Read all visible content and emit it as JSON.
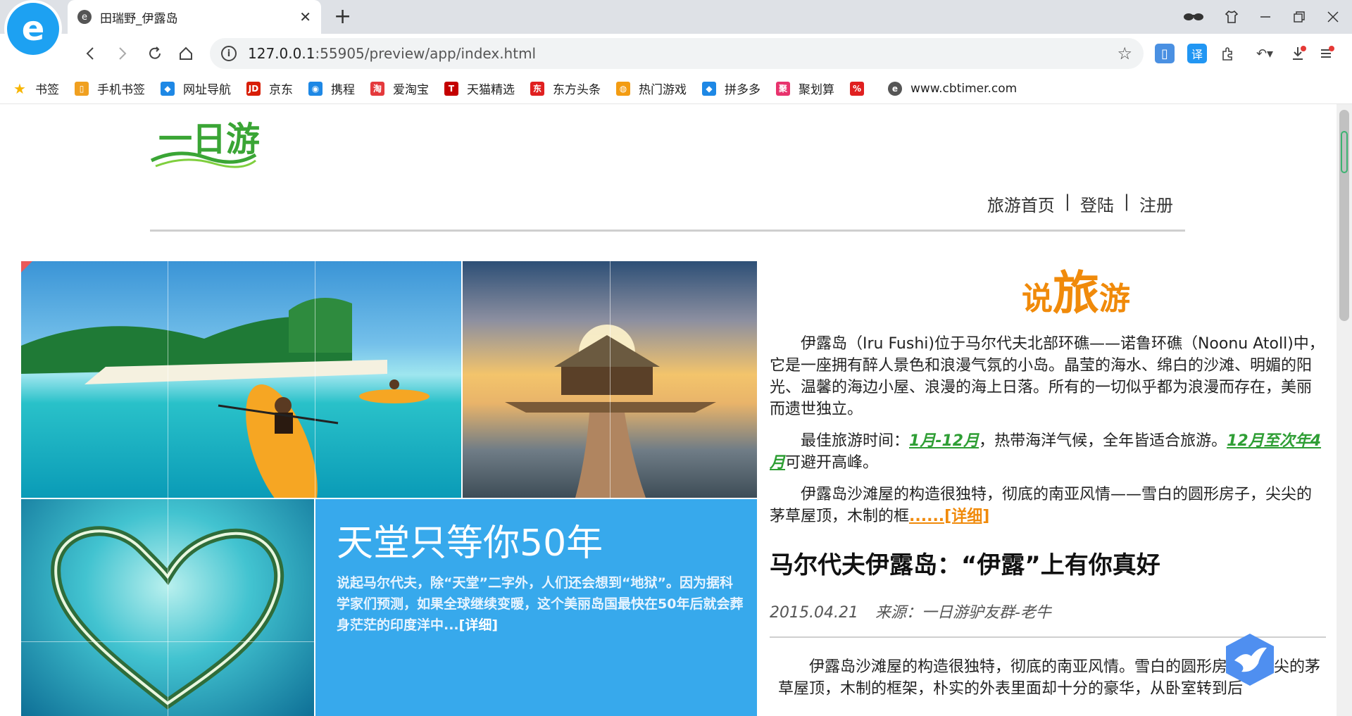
{
  "browser": {
    "tab_title": "田瑞野_伊露岛",
    "tab_close": "✕",
    "new_tab": "+",
    "url_host": "127.0.0.1",
    "url_rest": ":55905/preview/app/index.html",
    "logo_letter": "e"
  },
  "bookmarks": [
    {
      "label": "书签",
      "icon": "star-icon",
      "color": "#f7b500"
    },
    {
      "label": "手机书签",
      "icon": "phone-icon",
      "color": "#f0a020"
    },
    {
      "label": "网址导航",
      "icon": "nav-icon",
      "color": "#1e88e5"
    },
    {
      "label": "京东",
      "icon": "jd-icon",
      "color": "#d81e06"
    },
    {
      "label": "携程",
      "icon": "ctrip-icon",
      "color": "#1e88e5"
    },
    {
      "label": "爱淘宝",
      "icon": "taobao-icon",
      "color": "#e4393c"
    },
    {
      "label": "天猫精选",
      "icon": "tmall-icon",
      "color": "#c40000"
    },
    {
      "label": "东方头条",
      "icon": "dongfang-icon",
      "color": "#e02020"
    },
    {
      "label": "热门游戏",
      "icon": "game-icon",
      "color": "#f39c12"
    },
    {
      "label": "拼多多",
      "icon": "pdd-icon",
      "color": "#1e88e5"
    },
    {
      "label": "聚划算",
      "icon": "juhuasuan-icon",
      "color": "#e8336d"
    },
    {
      "label": "",
      "icon": "sale-icon",
      "color": "#e02020"
    },
    {
      "label": "www.cbtimer.com",
      "icon": "cbtimer-icon",
      "color": "#555555"
    }
  ],
  "site": {
    "nav": {
      "home": "旅游首页",
      "login": "登陆",
      "register": "注册",
      "sep1": "|",
      "sep2": "|"
    },
    "promo": {
      "title": "天堂只等你50年",
      "text": "说起马尔代夫，除“天堂”二字外，人们还会想到“地狱”。因为据科学家们预测，如果全球继续变暖，这个美丽岛国最快在50年后就会葬身茫茫的印度洋中...",
      "more": "[详细]"
    },
    "say": {
      "s1": "说",
      "big": "旅",
      "s2": "游"
    },
    "intro": "伊露岛（Iru Fushi)位于马尔代夫北部环礁——诺鲁环礁（Noonu Atoll)中，它是一座拥有醉人景色和浪漫气氛的小岛。晶莹的海水、绵白的沙滩、明媚的阳光、温馨的海边小屋、浪漫的海上日落。所有的一切似乎都为浪漫而存在，美丽而遗世独立。",
    "best": {
      "prefix": "最佳旅游时间：",
      "range1": "1月-12月",
      "mid": "，热带海洋气候，全年皆适合旅游。",
      "range2": "12月至次年4月",
      "suffix": "可避开高峰。"
    },
    "struct": {
      "text": "伊露岛沙滩屋的构造很独特，彻底的南亚风情——雪白的圆形房子，尖尖的茅草屋顶，木制的框",
      "more": "......[详细]"
    },
    "article": {
      "title": "马尔代夫伊露岛：“伊露”上有你真好",
      "date": "2015.04.21",
      "source": "来源：一日游驴友群-老牛",
      "body": "伊露岛沙滩屋的构造很独特，彻底的南亚风情。雪白的圆形房子，尖尖的茅草屋顶，木制的框架，朴实的外表里面却十分的豪华，从卧室转到后"
    }
  },
  "colors": {
    "accent_orange": "#f08a0a",
    "accent_green": "#2e9e34",
    "promo_blue": "#37a9ec",
    "logo_green": "#3aa535"
  }
}
